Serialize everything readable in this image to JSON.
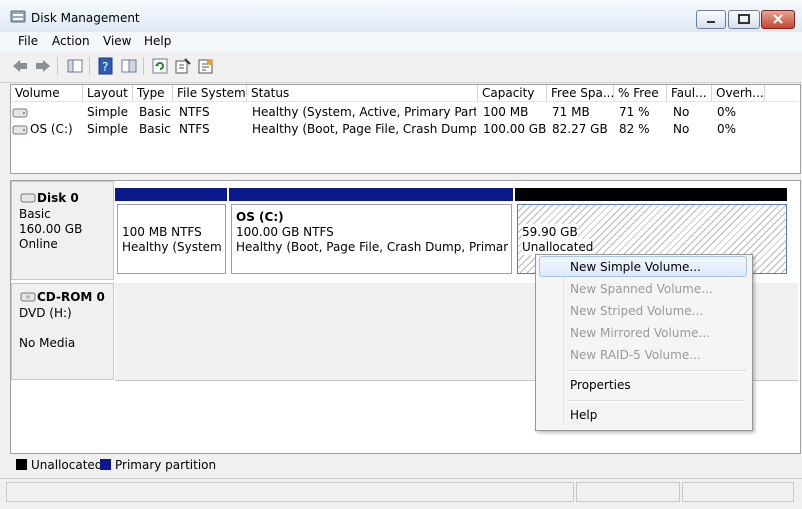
{
  "window": {
    "title": "Disk Management"
  },
  "menu": [
    "File",
    "Action",
    "View",
    "Help"
  ],
  "toolbar": {
    "icons": [
      "back-arrow-icon",
      "forward-arrow-icon",
      "console-tree-icon",
      "help-icon",
      "properties-pane-icon",
      "refresh-icon",
      "properties-icon",
      "rescan-icon"
    ]
  },
  "volume_list": {
    "columns": [
      "Volume",
      "Layout",
      "Type",
      "File System",
      "Status",
      "Capacity",
      "Free Spa...",
      "% Free",
      "Faul...",
      "Overh..."
    ],
    "rows": [
      {
        "volume": "",
        "layout": "Simple",
        "type": "Basic",
        "fs": "NTFS",
        "status": "Healthy (System, Active, Primary Partiti...",
        "capacity": "100 MB",
        "free": "71 MB",
        "pct": "71 %",
        "fault": "No",
        "overhead": "0%"
      },
      {
        "volume": "OS (C:)",
        "layout": "Simple",
        "type": "Basic",
        "fs": "NTFS",
        "status": "Healthy (Boot, Page File, Crash Dump, P...",
        "capacity": "100.00 GB",
        "free": "82.27 GB",
        "pct": "82 %",
        "fault": "No",
        "overhead": "0%"
      }
    ]
  },
  "disks": {
    "disk0": {
      "name": "Disk 0",
      "type": "Basic",
      "size": "160.00 GB",
      "state": "Online",
      "partitions": [
        {
          "size_fs": "100 MB NTFS",
          "status": "Healthy (System, A"
        },
        {
          "name": "OS  (C:)",
          "size_fs": "100.00 GB NTFS",
          "status": "Healthy (Boot, Page File, Crash Dump, Primary Part"
        },
        {
          "size": "59.90 GB",
          "status": "Unallocated"
        }
      ]
    },
    "cdrom0": {
      "name": "CD-ROM 0",
      "drive": "DVD (H:)",
      "media": "No Media"
    }
  },
  "legend": {
    "unallocated": "Unallocated",
    "primary": "Primary partition"
  },
  "colors": {
    "primary": "#0a1a8c",
    "unallocated": "#000000",
    "highlight": "#dceafb"
  },
  "context_menu": {
    "items": [
      {
        "label": "New Simple Volume...",
        "enabled": true
      },
      {
        "label": "New Spanned Volume...",
        "enabled": false
      },
      {
        "label": "New Striped Volume...",
        "enabled": false
      },
      {
        "label": "New Mirrored Volume...",
        "enabled": false
      },
      {
        "label": "New RAID-5 Volume...",
        "enabled": false
      },
      {
        "label": "Properties",
        "enabled": true
      },
      {
        "label": "Help",
        "enabled": true
      }
    ]
  }
}
